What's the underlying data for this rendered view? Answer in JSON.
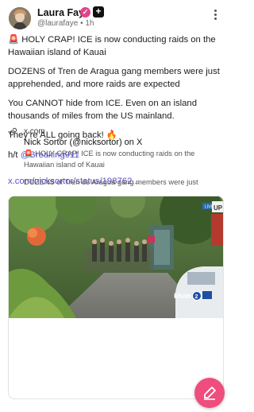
{
  "author": {
    "name": "Laura Faye",
    "handle": "@laurafaye",
    "time_sep": " • ",
    "time": "1h",
    "verified_icon": "check-badge-icon",
    "plus_badge": "+"
  },
  "post": {
    "line1": "🚨 HOLY CRAP! ICE is now conducting raids on the Hawaiian island of Kauai",
    "line2": "DOZENS of Tren de Aragua gang members were just apprehended, and more raids are expected",
    "line3": "You CANNOT hide from ICE. Even on an island thousands of miles from the US mainland.",
    "line4": "They’re ALL going back! 🔥",
    "ht_prefix": "h/t ",
    "ht_mention": "@Breaking911",
    "link": "x.com/nicksortor/status/198762..."
  },
  "card": {
    "domain": "x.com",
    "title": "Nick Sortor (@nicksortor) on X",
    "desc1": "🚨 HOLY CRAP! ICE is now conducting raids on the Hawaiian island of Kauai",
    "desc2": "DOZENS of Tren de Aragua gang members were just",
    "watermark": "khon",
    "channel_num": "2",
    "live_tag": "LIVE",
    "up_tag": "UP"
  },
  "colors": {
    "accent": "#5a4fcf",
    "fab": "#ee4d7d",
    "verified": "#e0458a"
  },
  "icons": {
    "more": "more-vertical-icon",
    "link": "link-icon",
    "compose": "compose-icon"
  }
}
